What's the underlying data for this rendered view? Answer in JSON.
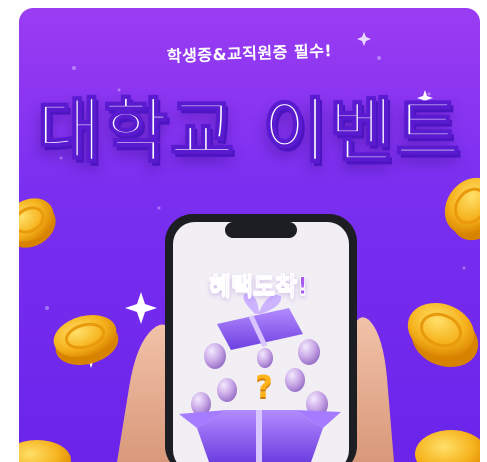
{
  "banner": {
    "subtitle": "학생증&교직원증 필수!",
    "title": "대학교 이벤트",
    "screen_text": "혜택도착!",
    "question_mark": "?"
  },
  "colors": {
    "background_top": "#9b3cf2",
    "background_bottom": "#6a24ea",
    "coin": "#f6b21c",
    "phone_screen": "#f1eef4",
    "gift": "#8f5df0",
    "balloon": "#c8a6e6",
    "hand": "#e8b39a"
  },
  "icons": [
    "sparkle-icon",
    "coin-icon",
    "gift-box-icon",
    "balloon-icon",
    "smartphone-icon"
  ]
}
